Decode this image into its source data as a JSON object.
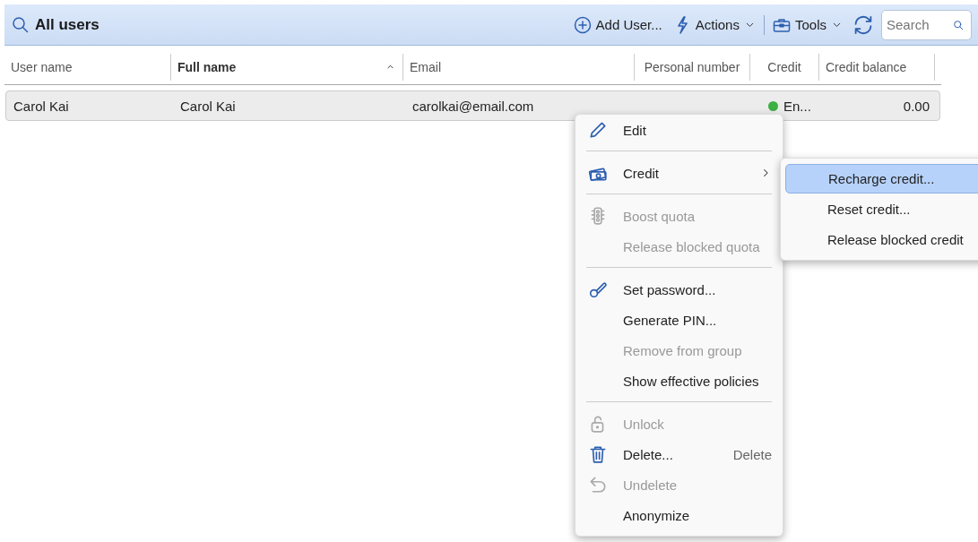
{
  "toolbar": {
    "title": "All users",
    "add_user": "Add User...",
    "actions": "Actions",
    "tools": "Tools",
    "search": {
      "placeholder": "Search"
    }
  },
  "table": {
    "columns": [
      {
        "label": "User name",
        "sorted": false
      },
      {
        "label": "Full name",
        "sorted": true
      },
      {
        "label": "Email",
        "sorted": false
      },
      {
        "label": "Personal number",
        "sorted": false
      },
      {
        "label": "Credit",
        "sorted": false
      },
      {
        "label": "Credit balance",
        "sorted": false
      }
    ],
    "rows": [
      {
        "selected": true,
        "cells": [
          "Carol Kai",
          "Carol Kai",
          "carolkai@email.com",
          "",
          "En...",
          "0.00"
        ],
        "color": "#3cb043"
      }
    ]
  },
  "context_menu": {
    "items": [
      {
        "kind": "item",
        "label": "Edit",
        "disabled": false
      },
      {
        "kind": "separator"
      },
      {
        "kind": "submenu",
        "label": "Credit",
        "disabled": false
      },
      {
        "kind": "separator"
      },
      {
        "kind": "item",
        "label": "Boost quota",
        "disabled": true
      },
      {
        "kind": "item",
        "label": "Release blocked quota",
        "disabled": true
      },
      {
        "kind": "separator"
      },
      {
        "kind": "item",
        "label": "Set password...",
        "disabled": false
      },
      {
        "kind": "item",
        "label": "Generate PIN...",
        "disabled": false
      },
      {
        "kind": "item",
        "label": "Remove from group",
        "disabled": true
      },
      {
        "kind": "item",
        "label": "Show effective policies",
        "disabled": false
      },
      {
        "kind": "separator"
      },
      {
        "kind": "item",
        "label": "Unlock",
        "disabled": true
      },
      {
        "kind": "item",
        "label": "Delete...",
        "shortcut": "Delete",
        "disabled": false
      },
      {
        "kind": "item",
        "label": "Undelete",
        "disabled": true
      },
      {
        "kind": "item",
        "label": "Anonymize",
        "disabled": false
      }
    ]
  },
  "submenu": {
    "items": [
      {
        "label": "Recharge credit...",
        "selected": true
      },
      {
        "label": "Reset credit...",
        "selected": false
      },
      {
        "label": "Release blocked credit",
        "selected": false
      }
    ]
  }
}
